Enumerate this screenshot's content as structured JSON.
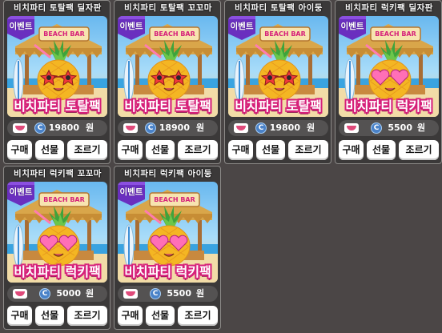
{
  "colors": {
    "background": "#4b4646",
    "card": "#3b3939",
    "pack_outline": "#d6207a",
    "event_badge": "#6a2fbf"
  },
  "icons": {
    "price": "coin-icon",
    "mouth": "mouth-icon"
  },
  "cards": [
    {
      "title": "비치파티 토탈팩 딜자판",
      "badge": "이벤트",
      "sign": "BEACH BAR",
      "pack_name": "비치파티 토탈팩",
      "price": "19800",
      "currency": "원",
      "buy": "구매",
      "gift": "선물",
      "inquire": "조르기",
      "glasses": "star"
    },
    {
      "title": "비치파티 토탈팩 꼬꼬마",
      "badge": "이벤트",
      "sign": "BEACH BAR",
      "pack_name": "비치파티 토탈팩",
      "price": "18900",
      "currency": "원",
      "buy": "구매",
      "gift": "선물",
      "inquire": "조르기",
      "glasses": "star"
    },
    {
      "title": "비치파티 토탈팩 아이둥",
      "badge": "이벤트",
      "sign": "BEACH BAR",
      "pack_name": "비치파티 토탈팩",
      "price": "19800",
      "currency": "원",
      "buy": "구매",
      "gift": "선물",
      "inquire": "조르기",
      "glasses": "star"
    },
    {
      "title": "비치파티 럭키팩 딜자판",
      "badge": "이벤트",
      "sign": "BEACH BAR",
      "pack_name": "비치파티 럭키팩",
      "price": "5500",
      "currency": "원",
      "buy": "구매",
      "gift": "선물",
      "inquire": "조르기",
      "glasses": "heart"
    },
    {
      "title": "비치파티 럭키팩 꼬꼬마",
      "badge": "이벤트",
      "sign": "BEACH BAR",
      "pack_name": "비치파티 럭키팩",
      "price": "5000",
      "currency": "원",
      "buy": "구매",
      "gift": "선물",
      "inquire": "조르기",
      "glasses": "heart"
    },
    {
      "title": "비치파티 럭키팩 아이둥",
      "badge": "이벤트",
      "sign": "BEACH BAR",
      "pack_name": "비치파티 럭키팩",
      "price": "5500",
      "currency": "원",
      "buy": "구매",
      "gift": "선물",
      "inquire": "조르기",
      "glasses": "heart"
    }
  ]
}
